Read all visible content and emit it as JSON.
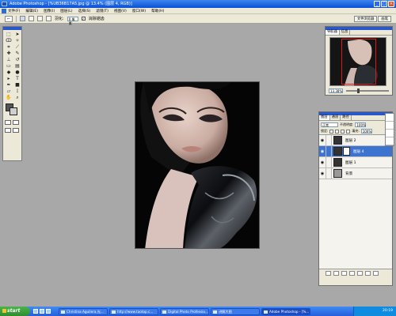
{
  "window": {
    "title": "Adobe Photoshop - [%UB36B17A5.jpg @ 13.4% (图层 4, RGB)]"
  },
  "menubar": {
    "items": [
      "文件(F)",
      "编辑(E)",
      "图像(I)",
      "图层(L)",
      "选择(S)",
      "滤镜(T)",
      "视图(V)",
      "窗口(W)",
      "帮助(H)"
    ]
  },
  "options": {
    "feather_label": "羽化:",
    "feather_value": "0 像素",
    "antialias_label": "消除锯齿"
  },
  "palette_well": {
    "tabs": [
      "文件浏览器",
      "画笔"
    ]
  },
  "navigator": {
    "tabs": [
      "导航器",
      "信息"
    ],
    "zoom": "13.38%"
  },
  "layers": {
    "tabs": [
      "图层",
      "通道",
      "路径"
    ],
    "blend_mode": "正常",
    "opacity_label": "不透明度:",
    "opacity": "100%",
    "lock_label": "锁定:",
    "fill_label": "填充:",
    "fill": "100%",
    "items": [
      {
        "name": "图层 2"
      },
      {
        "name": "图层 4"
      },
      {
        "name": "图层 1"
      },
      {
        "name": "背景"
      }
    ]
  },
  "taskbar": {
    "start": "start",
    "tasks": [
      "Christina Aguilera,光...",
      "http://www.taotop.c...",
      "Digital Photo Professio...",
      "讲解大图",
      "Adobe Photoshop - [%..."
    ],
    "clock": "20:19"
  }
}
